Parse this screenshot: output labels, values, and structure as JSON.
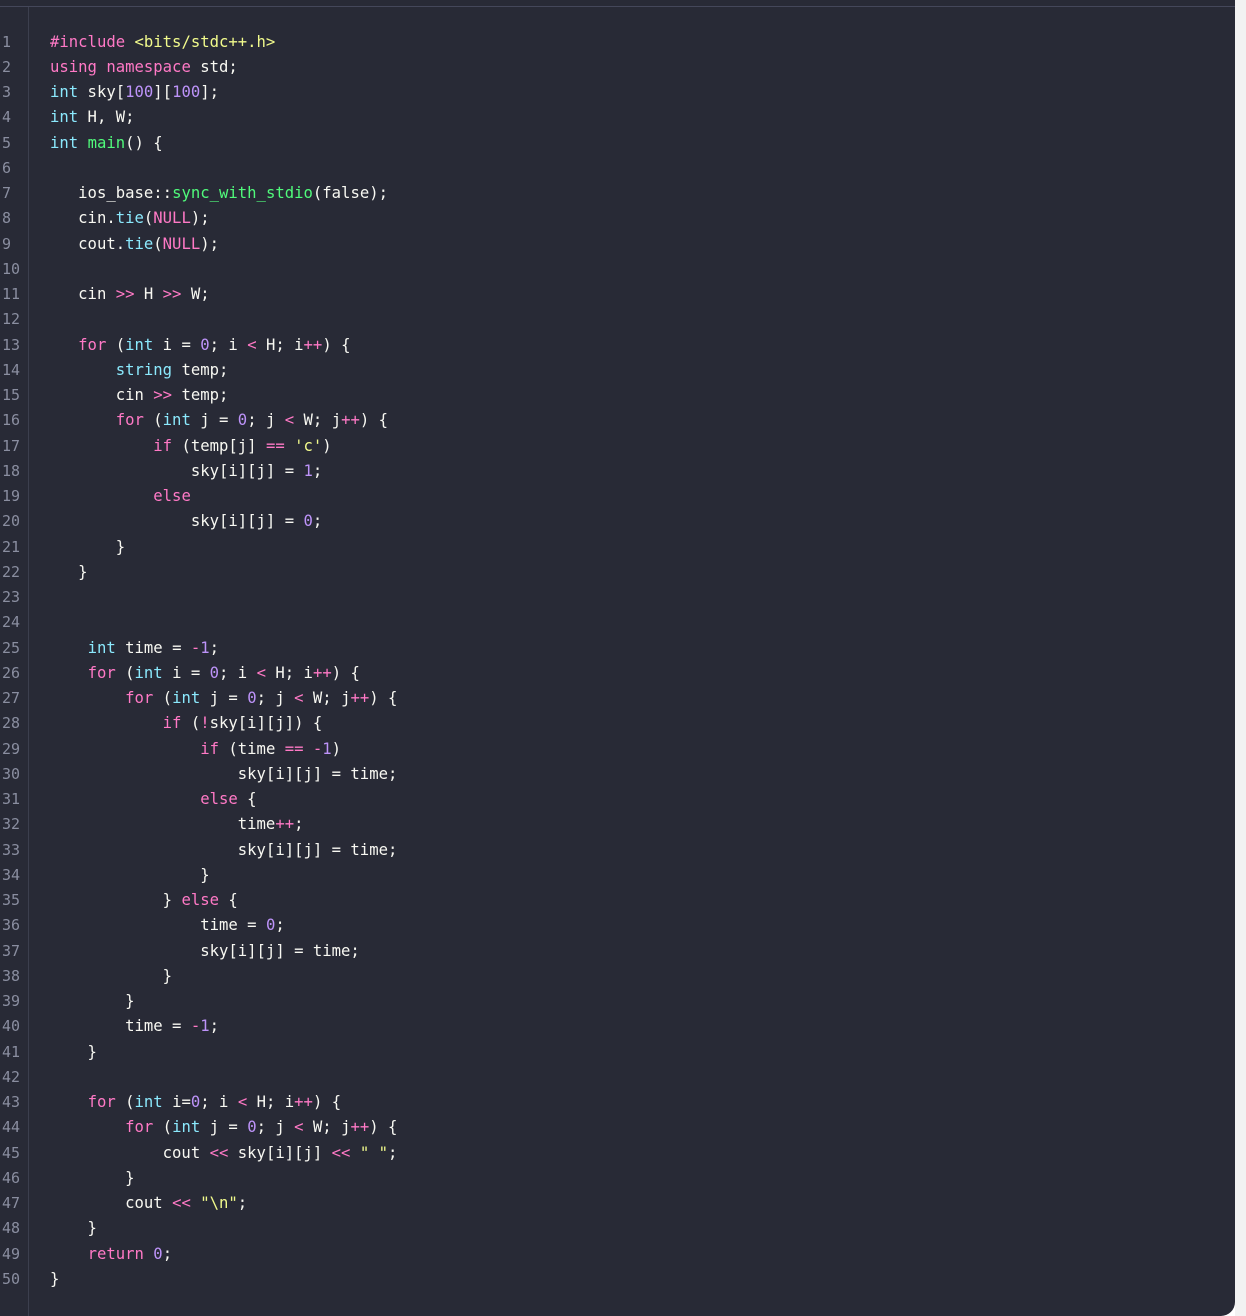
{
  "editor": {
    "language": "cpp",
    "theme_colors": {
      "background": "#282a36",
      "foreground": "#f8f8f2",
      "keyword": "#ff79c6",
      "type": "#8be9fd",
      "function": "#50fa7b",
      "number": "#bd93f9",
      "string": "#f1fa8c",
      "line_number": "#8a8ea0"
    },
    "lines": [
      [
        [
          "c",
          "#include "
        ],
        [
          "s",
          "<bits/stdc++.h>"
        ]
      ],
      [
        [
          "k",
          "using"
        ],
        [
          "p",
          " "
        ],
        [
          "k",
          "namespace"
        ],
        [
          "p",
          " std;"
        ]
      ],
      [
        [
          "t",
          "int"
        ],
        [
          "p",
          " sky["
        ],
        [
          "n",
          "100"
        ],
        [
          "p",
          "]["
        ],
        [
          "n",
          "100"
        ],
        [
          "p",
          "];"
        ]
      ],
      [
        [
          "t",
          "int"
        ],
        [
          "p",
          " H, W;"
        ]
      ],
      [
        [
          "t",
          "int"
        ],
        [
          "p",
          " "
        ],
        [
          "fn",
          "main"
        ],
        [
          "p",
          "() {"
        ]
      ],
      [],
      [
        [
          "p",
          "   ios_base::"
        ],
        [
          "fn",
          "sync_with_stdio"
        ],
        [
          "p",
          "(false);"
        ]
      ],
      [
        [
          "p",
          "   cin."
        ],
        [
          "t",
          "tie"
        ],
        [
          "p",
          "("
        ],
        [
          "k",
          "NULL"
        ],
        [
          "p",
          ");"
        ]
      ],
      [
        [
          "p",
          "   cout."
        ],
        [
          "t",
          "tie"
        ],
        [
          "p",
          "("
        ],
        [
          "k",
          "NULL"
        ],
        [
          "p",
          ");"
        ]
      ],
      [],
      [
        [
          "p",
          "   cin "
        ],
        [
          "o",
          ">>"
        ],
        [
          "p",
          " H "
        ],
        [
          "o",
          ">>"
        ],
        [
          "p",
          " W;"
        ]
      ],
      [],
      [
        [
          "p",
          "   "
        ],
        [
          "k",
          "for"
        ],
        [
          "p",
          " ("
        ],
        [
          "t",
          "int"
        ],
        [
          "p",
          " i = "
        ],
        [
          "n",
          "0"
        ],
        [
          "p",
          "; i "
        ],
        [
          "o",
          "<"
        ],
        [
          "p",
          " H; i"
        ],
        [
          "o",
          "++"
        ],
        [
          "p",
          ") {"
        ]
      ],
      [
        [
          "p",
          "       "
        ],
        [
          "t",
          "string"
        ],
        [
          "p",
          " temp;"
        ]
      ],
      [
        [
          "p",
          "       cin "
        ],
        [
          "o",
          ">>"
        ],
        [
          "p",
          " temp;"
        ]
      ],
      [
        [
          "p",
          "       "
        ],
        [
          "k",
          "for"
        ],
        [
          "p",
          " ("
        ],
        [
          "t",
          "int"
        ],
        [
          "p",
          " j = "
        ],
        [
          "n",
          "0"
        ],
        [
          "p",
          "; j "
        ],
        [
          "o",
          "<"
        ],
        [
          "p",
          " W; j"
        ],
        [
          "o",
          "++"
        ],
        [
          "p",
          ") {"
        ]
      ],
      [
        [
          "p",
          "           "
        ],
        [
          "k",
          "if"
        ],
        [
          "p",
          " (temp[j] "
        ],
        [
          "o",
          "=="
        ],
        [
          "p",
          " "
        ],
        [
          "s",
          "'c'"
        ],
        [
          "p",
          ")"
        ]
      ],
      [
        [
          "p",
          "               sky[i][j] = "
        ],
        [
          "n",
          "1"
        ],
        [
          "p",
          ";"
        ]
      ],
      [
        [
          "p",
          "           "
        ],
        [
          "k",
          "else"
        ]
      ],
      [
        [
          "p",
          "               sky[i][j] = "
        ],
        [
          "n",
          "0"
        ],
        [
          "p",
          ";"
        ]
      ],
      [
        [
          "p",
          "       }"
        ]
      ],
      [
        [
          "p",
          "   }"
        ]
      ],
      [],
      [],
      [
        [
          "p",
          "    "
        ],
        [
          "t",
          "int"
        ],
        [
          "p",
          " time = "
        ],
        [
          "o",
          "-"
        ],
        [
          "n",
          "1"
        ],
        [
          "p",
          ";"
        ]
      ],
      [
        [
          "p",
          "    "
        ],
        [
          "k",
          "for"
        ],
        [
          "p",
          " ("
        ],
        [
          "t",
          "int"
        ],
        [
          "p",
          " i = "
        ],
        [
          "n",
          "0"
        ],
        [
          "p",
          "; i "
        ],
        [
          "o",
          "<"
        ],
        [
          "p",
          " H; i"
        ],
        [
          "o",
          "++"
        ],
        [
          "p",
          ") {"
        ]
      ],
      [
        [
          "p",
          "        "
        ],
        [
          "k",
          "for"
        ],
        [
          "p",
          " ("
        ],
        [
          "t",
          "int"
        ],
        [
          "p",
          " j = "
        ],
        [
          "n",
          "0"
        ],
        [
          "p",
          "; j "
        ],
        [
          "o",
          "<"
        ],
        [
          "p",
          " W; j"
        ],
        [
          "o",
          "++"
        ],
        [
          "p",
          ") {"
        ]
      ],
      [
        [
          "p",
          "            "
        ],
        [
          "k",
          "if"
        ],
        [
          "p",
          " ("
        ],
        [
          "o",
          "!"
        ],
        [
          "p",
          "sky[i][j]) {"
        ]
      ],
      [
        [
          "p",
          "                "
        ],
        [
          "k",
          "if"
        ],
        [
          "p",
          " (time "
        ],
        [
          "o",
          "=="
        ],
        [
          "p",
          " "
        ],
        [
          "o",
          "-"
        ],
        [
          "n",
          "1"
        ],
        [
          "p",
          ")"
        ]
      ],
      [
        [
          "p",
          "                    sky[i][j] = time;"
        ]
      ],
      [
        [
          "p",
          "                "
        ],
        [
          "k",
          "else"
        ],
        [
          "p",
          " {"
        ]
      ],
      [
        [
          "p",
          "                    time"
        ],
        [
          "o",
          "++"
        ],
        [
          "p",
          ";"
        ]
      ],
      [
        [
          "p",
          "                    sky[i][j] = time;"
        ]
      ],
      [
        [
          "p",
          "                }"
        ]
      ],
      [
        [
          "p",
          "            } "
        ],
        [
          "k",
          "else"
        ],
        [
          "p",
          " {"
        ]
      ],
      [
        [
          "p",
          "                time = "
        ],
        [
          "n",
          "0"
        ],
        [
          "p",
          ";"
        ]
      ],
      [
        [
          "p",
          "                sky[i][j] = time;"
        ]
      ],
      [
        [
          "p",
          "            }"
        ]
      ],
      [
        [
          "p",
          "        }"
        ]
      ],
      [
        [
          "p",
          "        time = "
        ],
        [
          "o",
          "-"
        ],
        [
          "n",
          "1"
        ],
        [
          "p",
          ";"
        ]
      ],
      [
        [
          "p",
          "    }"
        ]
      ],
      [],
      [
        [
          "p",
          "    "
        ],
        [
          "k",
          "for"
        ],
        [
          "p",
          " ("
        ],
        [
          "t",
          "int"
        ],
        [
          "p",
          " i="
        ],
        [
          "n",
          "0"
        ],
        [
          "p",
          "; i "
        ],
        [
          "o",
          "<"
        ],
        [
          "p",
          " H; i"
        ],
        [
          "o",
          "++"
        ],
        [
          "p",
          ") {"
        ]
      ],
      [
        [
          "p",
          "        "
        ],
        [
          "k",
          "for"
        ],
        [
          "p",
          " ("
        ],
        [
          "t",
          "int"
        ],
        [
          "p",
          " j = "
        ],
        [
          "n",
          "0"
        ],
        [
          "p",
          "; j "
        ],
        [
          "o",
          "<"
        ],
        [
          "p",
          " W; j"
        ],
        [
          "o",
          "++"
        ],
        [
          "p",
          ") {"
        ]
      ],
      [
        [
          "p",
          "            cout "
        ],
        [
          "o",
          "<<"
        ],
        [
          "p",
          " sky[i][j] "
        ],
        [
          "o",
          "<<"
        ],
        [
          "p",
          " "
        ],
        [
          "s",
          "\" \""
        ],
        [
          "p",
          ";"
        ]
      ],
      [
        [
          "p",
          "        }"
        ]
      ],
      [
        [
          "p",
          "        cout "
        ],
        [
          "o",
          "<<"
        ],
        [
          "p",
          " "
        ],
        [
          "s",
          "\"\\n\""
        ],
        [
          "p",
          ";"
        ]
      ],
      [
        [
          "p",
          "    }"
        ]
      ],
      [
        [
          "p",
          "    "
        ],
        [
          "k",
          "return"
        ],
        [
          "p",
          " "
        ],
        [
          "n",
          "0"
        ],
        [
          "p",
          ";"
        ]
      ],
      [
        [
          "p",
          "}"
        ]
      ]
    ]
  }
}
